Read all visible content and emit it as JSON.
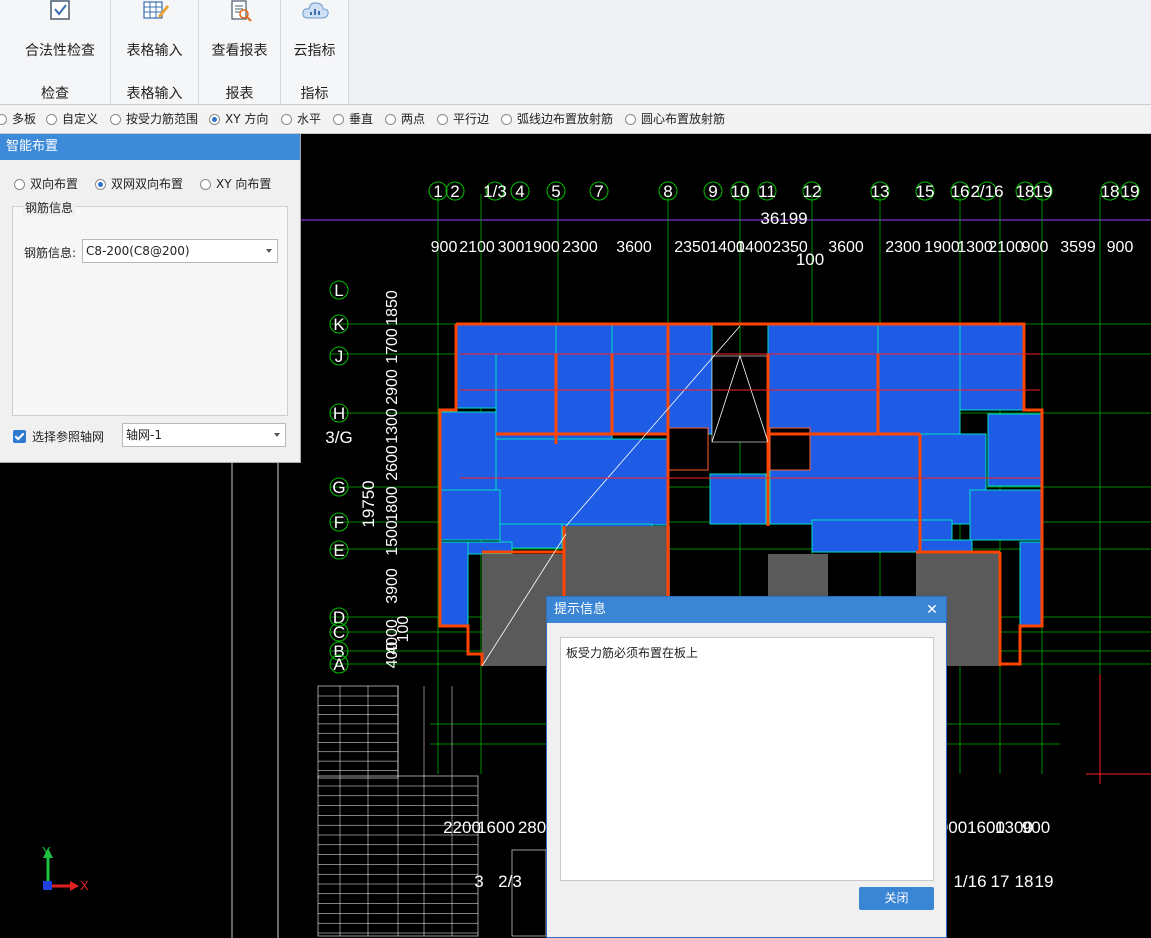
{
  "ribbon": {
    "groups": [
      {
        "label": "检查",
        "button": "合法性检查",
        "icon": "checkbox-icon"
      },
      {
        "label": "表格输入",
        "button": "表格输入",
        "icon": "table-edit-icon"
      },
      {
        "label": "报表",
        "button": "查看报表",
        "icon": "report-search-icon"
      },
      {
        "label": "指标",
        "button": "云指标",
        "icon": "cloud-chart-icon"
      }
    ]
  },
  "options": {
    "items": [
      {
        "label": "多板",
        "checked": false
      },
      {
        "label": "自定义",
        "checked": false
      },
      {
        "label": "按受力筋范围",
        "checked": false
      },
      {
        "label": "XY 方向",
        "checked": true
      },
      {
        "label": "水平",
        "checked": false
      },
      {
        "label": "垂直",
        "checked": false
      },
      {
        "label": "两点",
        "checked": false
      },
      {
        "label": "平行边",
        "checked": false
      },
      {
        "label": "弧线边布置放射筋",
        "checked": false
      },
      {
        "label": "圆心布置放射筋",
        "checked": false
      }
    ]
  },
  "panel": {
    "title": "智能布置",
    "radios": [
      {
        "label": "双向布置",
        "checked": false
      },
      {
        "label": "双网双向布置",
        "checked": true
      },
      {
        "label": "XY 向布置",
        "checked": false
      }
    ],
    "group_title": "钢筋信息",
    "rebar_label": "钢筋信息:",
    "rebar_value": "C8-200(C8@200)",
    "ref_axis_label": "选择参照轴网",
    "ref_axis_checked": true,
    "ref_axis_value": "轴网-1"
  },
  "cad": {
    "axis_top_labels": [
      "1",
      "2",
      "1/3",
      "4",
      "5",
      "7",
      "8",
      "9",
      "10",
      "11",
      "12",
      "13",
      "15",
      "16",
      "2/16",
      "18",
      "19",
      "18",
      "19"
    ],
    "total_dim": "36199",
    "top_dims": [
      "900",
      "2100",
      "300",
      "1900",
      "2300",
      "3600",
      "2350",
      "1400",
      "1400",
      "2350",
      "3600",
      "2300",
      "1900",
      "1300",
      "2100",
      "900",
      "3599",
      "900"
    ],
    "sub_dim": "100",
    "axis_left_labels": [
      "L",
      "K",
      "J",
      "H",
      "3/G",
      "G",
      "F",
      "E",
      "D",
      "C",
      "B",
      "A"
    ],
    "left_dims": [
      "1850",
      "1700",
      "2900",
      "1300",
      "2600",
      "1800",
      "1500",
      "3900",
      "4000",
      "100",
      "400"
    ],
    "left_total": "19750",
    "bottom_dims": [
      "2200",
      "1600",
      "280",
      "900",
      "1600",
      "1300",
      "900"
    ],
    "bottom_axis_labels": [
      "3",
      "2/3",
      "1/16",
      "17",
      "18",
      "19"
    ],
    "ucs": {
      "x": "X",
      "y": "Y"
    }
  },
  "dialog": {
    "title": "提示信息",
    "message": "板受力筋必须布置在板上",
    "close_label": "关闭"
  },
  "colors": {
    "slab": "#1e5ce6",
    "beam": "#ff4500",
    "axis": "#00c000",
    "accent": "#3a86d4"
  }
}
